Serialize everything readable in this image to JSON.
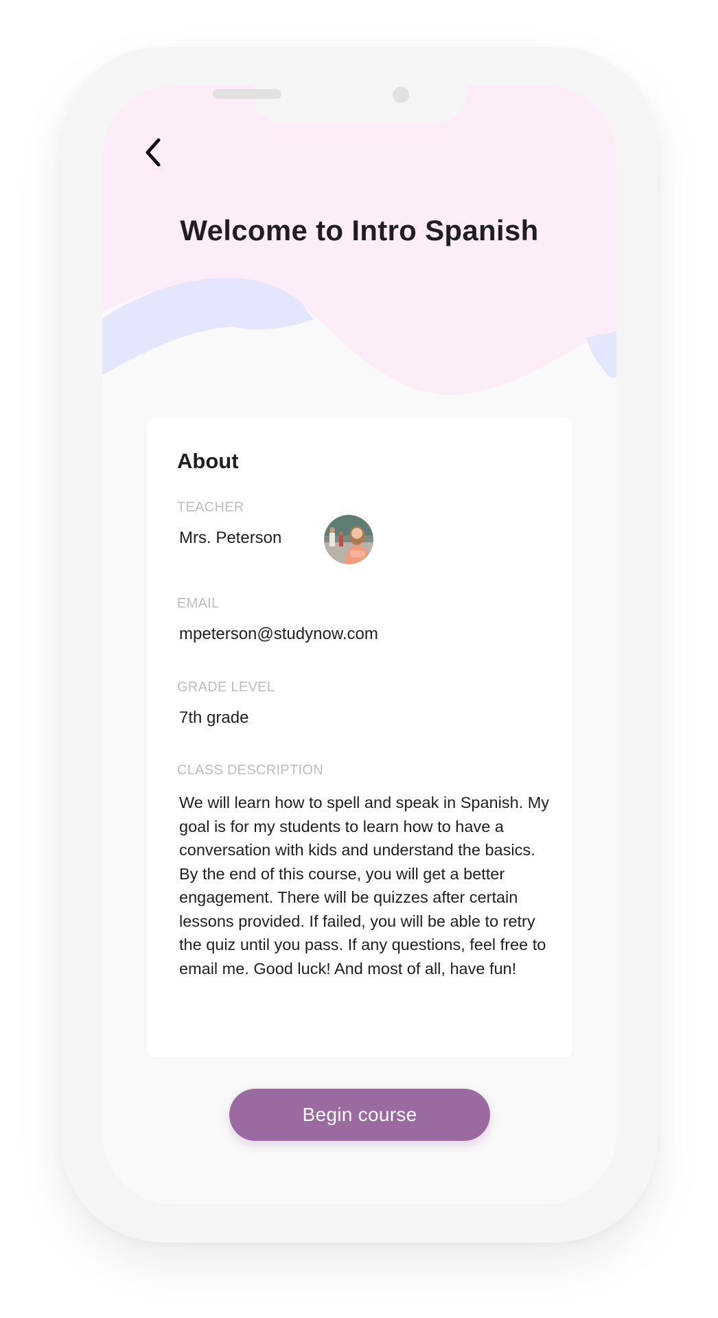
{
  "header": {
    "title": "Welcome to Intro Spanish",
    "back_icon": "chevron-left-icon"
  },
  "about": {
    "title": "About",
    "teacher": {
      "label": "TEACHER",
      "value": "Mrs. Peterson",
      "avatar_icon": "teacher-avatar"
    },
    "email": {
      "label": "EMAIL",
      "value": "mpeterson@studynow.com"
    },
    "grade_level": {
      "label": "GRADE LEVEL",
      "value": "7th grade"
    },
    "class_description": {
      "label": "CLASS DESCRIPTION",
      "value": "We will learn how to spell and speak in Spanish. My goal is for my students to learn how to have a conversation with kids and understand the basics. By the end of this course, you will get a better engagement. There will be quizzes after certain lessons provided. If failed, you will be able to retry the quiz until you pass. If any questions, feel free to email me. Good luck! And most of all, have fun!"
    }
  },
  "actions": {
    "begin_label": "Begin course"
  },
  "colors": {
    "header_pink": "#fdedf8",
    "wave_blue": "#e3e6fd",
    "screen_bg": "#f9f9f9",
    "accent_purple": "#9b6aa0",
    "text_dark": "#1e1e24",
    "label_gray": "#bcbcbc"
  }
}
